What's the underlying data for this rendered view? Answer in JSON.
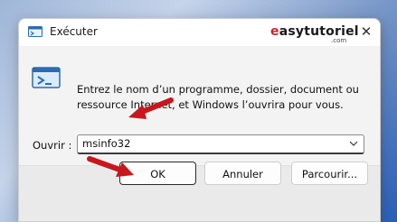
{
  "window": {
    "title": "Exécuter",
    "close_glyph": "✕",
    "watermark_prefix": "e",
    "watermark_rest": "asytutoriel",
    "watermark_suffix": ".com"
  },
  "content": {
    "description": "Entrez le nom d’un programme, dossier, document ou ressource Internet, et Windows l’ouvrira pour vous.",
    "open_label": "Ouvrir :",
    "open_value": "msinfo32"
  },
  "buttons": {
    "ok": "OK",
    "cancel": "Annuler",
    "browse": "Parcourir..."
  },
  "colors": {
    "accent": "#d3202a",
    "dialog_bg": "#f3f3f3"
  },
  "icons": {
    "title": "run-dialog-icon",
    "content": "run-program-icon",
    "close": "close-icon",
    "dropdown": "chevron-down-icon",
    "annotation": "red-arrow"
  }
}
